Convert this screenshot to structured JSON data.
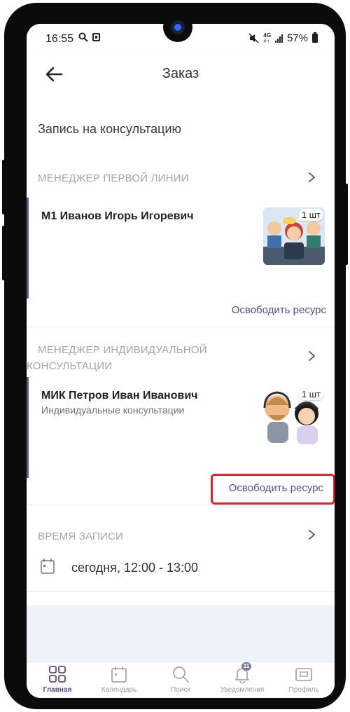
{
  "status_bar": {
    "time": "16:55",
    "net_top": "4G",
    "net_bottom": "+↑",
    "battery": "57%"
  },
  "header": {
    "title": "Заказ"
  },
  "page": {
    "subtitle": "Запись на консультацию"
  },
  "sections": {
    "first_line": {
      "header": "МЕНЕДЖЕР ПЕРВОЙ ЛИНИИ",
      "name": "М1 Иванов Игорь Игоревич",
      "quantity": "1 шт",
      "release_label": "Освободить ресурс"
    },
    "individual": {
      "header_line1": "МЕНЕДЖЕР ИНДИВИДУАЛЬНОЙ",
      "header_line2": "КОНСУЛЬТАЦИИ",
      "name": "МИК Петров Иван Иванович",
      "description": "Индивидуальные консультации",
      "quantity": "1 шт",
      "release_label": "Освободить ресурс"
    },
    "time": {
      "header": "ВРЕМЯ ЗАПИСИ",
      "value": "сегодня, 12:00 - 13:00"
    }
  },
  "bottom_nav": {
    "items": [
      {
        "label": "Главная",
        "icon": "grid-icon",
        "active": true
      },
      {
        "label": "Календарь",
        "icon": "calendar-icon",
        "active": false
      },
      {
        "label": "Поиск",
        "icon": "search-icon",
        "active": false
      },
      {
        "label": "Уведомления",
        "icon": "bell-icon",
        "active": false
      },
      {
        "label": "Профиль",
        "icon": "profile-card-icon",
        "active": false
      }
    ],
    "notification_count": "11"
  },
  "colors": {
    "accent": "#5b4a86",
    "highlight": "#e0262c",
    "header_text": "#a4a4a4"
  }
}
